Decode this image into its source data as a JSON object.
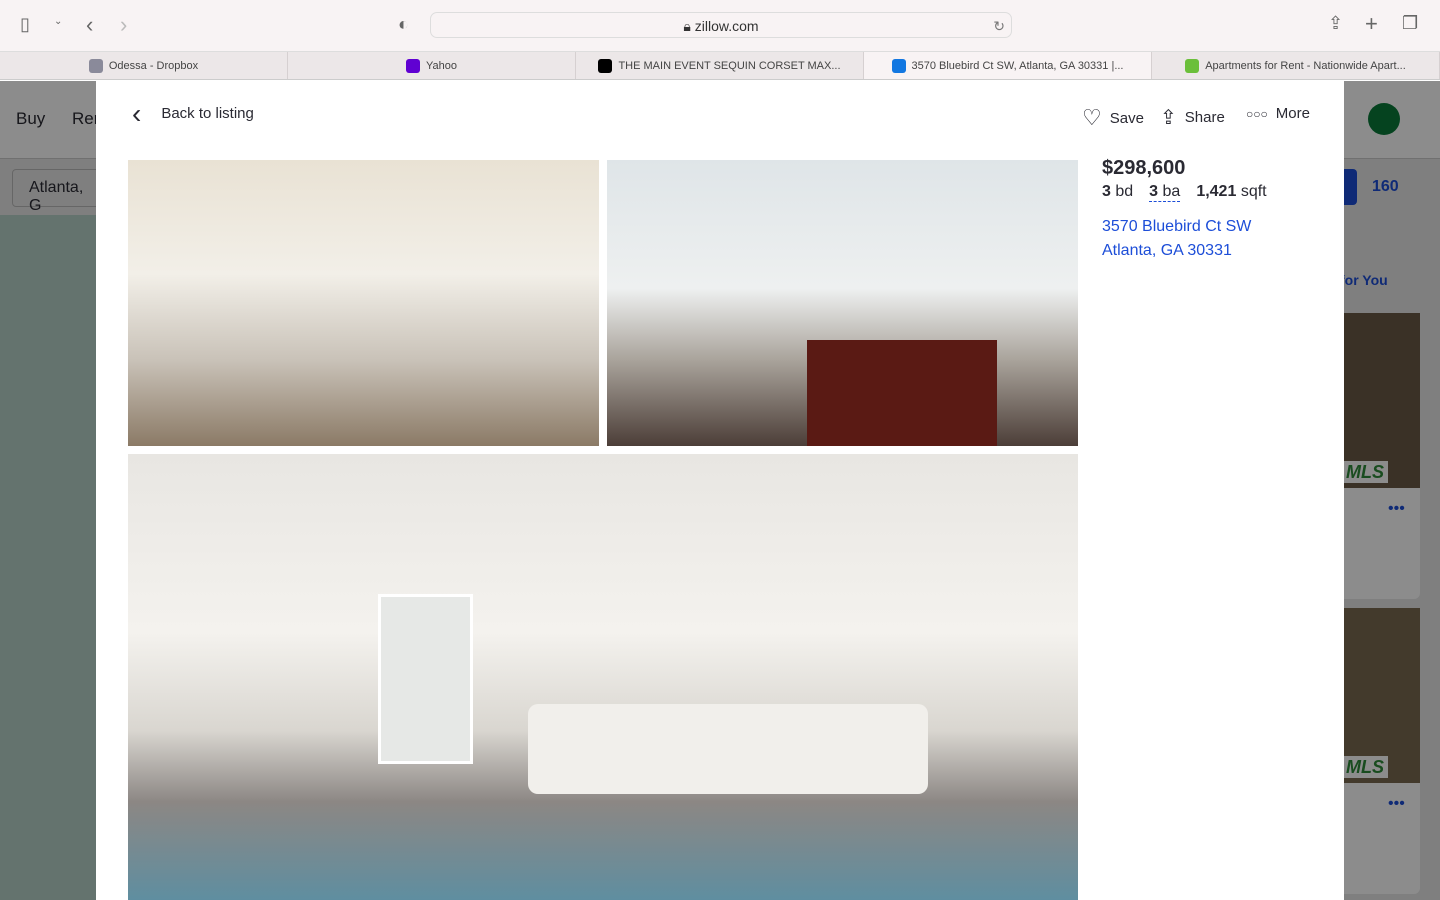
{
  "browser": {
    "url": "zillow.com",
    "tabs": [
      {
        "label": "Odessa - Dropbox",
        "icon": "dropbox-d",
        "color": "#8a8a9a"
      },
      {
        "label": "Yahoo",
        "icon": "yahoo",
        "color": "#6001d2"
      },
      {
        "label": "THE MAIN EVENT SEQUIN CORSET MAX...",
        "icon": "letter-a",
        "color": "#000"
      },
      {
        "label": "3570 Bluebird Ct SW, Atlanta, GA 30331 |...",
        "icon": "zillow",
        "color": "#1277e1",
        "active": true
      },
      {
        "label": "Apartments for Rent - Nationwide Apart...",
        "icon": "apartments",
        "color": "#6bbf3a"
      }
    ]
  },
  "background": {
    "nav": [
      "Buy",
      "Ren"
    ],
    "search": "Atlanta, G",
    "count": "160",
    "sort": "for You",
    "mls": "MLS"
  },
  "modal": {
    "back": "Back to listing",
    "save": "Save",
    "share": "Share",
    "more": "More",
    "price": "$298,600",
    "beds": "3",
    "beds_unit": "bd",
    "baths": "3",
    "baths_unit": "ba",
    "sqft": "1,421",
    "sqft_unit": "sqft",
    "address_line1": "3570 Bluebird Ct SW",
    "address_line2": "Atlanta, GA 30331"
  },
  "colors": {
    "link": "#1d4ed8",
    "brand": "#1277e1"
  }
}
